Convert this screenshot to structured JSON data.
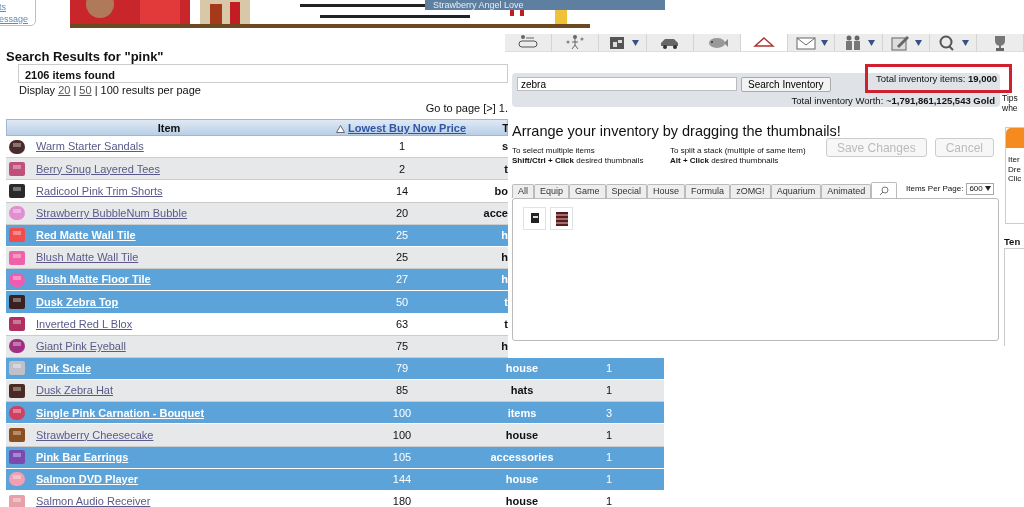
{
  "corner_links": [
    "ts",
    "essage"
  ],
  "toolbar": {
    "title": "Strawberry Angel Love"
  },
  "nav": {
    "items": [
      {
        "selected": false,
        "menu": false
      },
      {
        "selected": false,
        "menu": false
      },
      {
        "selected": false,
        "menu": true
      },
      {
        "selected": false,
        "menu": false
      },
      {
        "selected": false,
        "menu": false
      },
      {
        "selected": true,
        "menu": false
      },
      {
        "selected": false,
        "menu": true
      },
      {
        "selected": false,
        "menu": true
      },
      {
        "selected": false,
        "menu": true
      },
      {
        "selected": false,
        "menu": true
      },
      {
        "selected": false,
        "menu": false
      }
    ]
  },
  "heading": "Search Results for \"pink\"",
  "count": "2106 items found",
  "display": {
    "prefix": "Display",
    "separator": "|",
    "options": [
      {
        "label": "20",
        "link": true
      },
      {
        "label": "50",
        "link": true
      },
      {
        "label": "100",
        "link": false
      }
    ],
    "suffix": "results per page"
  },
  "pager": "Go to page [>] 1.",
  "table": {
    "columns": [
      {
        "label": "Item",
        "sorted": false
      },
      {
        "label": "Lowest Buy Now Price",
        "sorted": true
      },
      {
        "label": "T",
        "sorted": false
      }
    ],
    "rows": [
      {
        "name": "Warm Starter Sandals",
        "price": "1",
        "type": "s",
        "highlighted": false
      },
      {
        "name": "Berry Snug Layered Tees",
        "price": "2",
        "type": "t",
        "highlighted": false
      },
      {
        "name": "Radicool Pink Trim Shorts",
        "price": "14",
        "type": "bo",
        "highlighted": false
      },
      {
        "name": "Strawberry BubbleNum Bubble",
        "price": "20",
        "type": "acce",
        "highlighted": false
      },
      {
        "name": "Red Matte Wall Tile",
        "price": "25",
        "type": "h",
        "highlighted": true
      },
      {
        "name": "Blush Matte Wall Tile",
        "price": "25",
        "type": "h",
        "highlighted": false
      },
      {
        "name": "Blush Matte Floor Tile",
        "price": "27",
        "type": "h",
        "highlighted": true
      },
      {
        "name": "Dusk Zebra Top",
        "price": "50",
        "type": "t",
        "highlighted": true
      },
      {
        "name": "Inverted Red L Blox",
        "price": "63",
        "type": "t",
        "highlighted": false
      },
      {
        "name": "Giant Pink Eyeball",
        "price": "75",
        "type": "h",
        "highlighted": false
      },
      {
        "name": "Pink Scale",
        "price": "79",
        "type": "house",
        "qty": "1",
        "highlighted": true
      },
      {
        "name": "Dusk Zebra Hat",
        "price": "85",
        "type": "hats",
        "qty": "1",
        "highlighted": false
      },
      {
        "name": "Single Pink Carnation - Bouquet",
        "price": "100",
        "type": "items",
        "qty": "3",
        "highlighted": true
      },
      {
        "name": "Strawberry Cheesecake",
        "price": "100",
        "type": "house",
        "qty": "1",
        "highlighted": false
      },
      {
        "name": "Pink Bar Earrings",
        "price": "105",
        "type": "accessories",
        "qty": "1",
        "highlighted": true
      },
      {
        "name": "Salmon DVD Player",
        "price": "144",
        "type": "house",
        "qty": "1",
        "highlighted": true
      },
      {
        "name": "Salmon Audio Receiver",
        "price": "180",
        "type": "house",
        "qty": "1",
        "highlighted": false
      }
    ]
  },
  "inventory": {
    "search": {
      "value": "zebra"
    },
    "search_button": "Search Inventory",
    "total_items": "Total inventory items: **19,000**",
    "worth": "Total inventory Worth: ~**1,791,861,125,543 Gold**",
    "title": "Arrange your inventory by dragging the thumbnails!",
    "hints": [
      {
        "text": "To select multiple items",
        "action": "**Shift/Ctrl + Click** desired thumbnails"
      },
      {
        "text": "To split a stack (multiple of same item)",
        "action": "**Alt + Click** desired thumbnails"
      }
    ],
    "buttons": [
      {
        "label": "Save Changes",
        "disabled": true
      },
      {
        "label": "Cancel",
        "disabled": true
      }
    ],
    "tabs": [
      {
        "kind": "text",
        "label": "All",
        "selected": false
      },
      {
        "kind": "text",
        "label": "Equip",
        "selected": false
      },
      {
        "kind": "text",
        "label": "Game",
        "selected": false
      },
      {
        "kind": "text",
        "label": "Special",
        "selected": false
      },
      {
        "kind": "text",
        "label": "House",
        "selected": false
      },
      {
        "kind": "text",
        "label": "Formula",
        "selected": false
      },
      {
        "kind": "text",
        "label": "zOMG!",
        "selected": false
      },
      {
        "kind": "text",
        "label": "Aquarium",
        "selected": false
      },
      {
        "kind": "text",
        "label": "Animated",
        "selected": false
      },
      {
        "kind": "search",
        "selected": true
      }
    ],
    "items_per_page": {
      "label": "Items Per Page:",
      "value": "600"
    }
  },
  "side": {
    "tips": [
      "Tips",
      "whe"
    ],
    "card_lines": [
      "Iter",
      "Dre",
      "Clic"
    ],
    "heading": "Ten"
  }
}
